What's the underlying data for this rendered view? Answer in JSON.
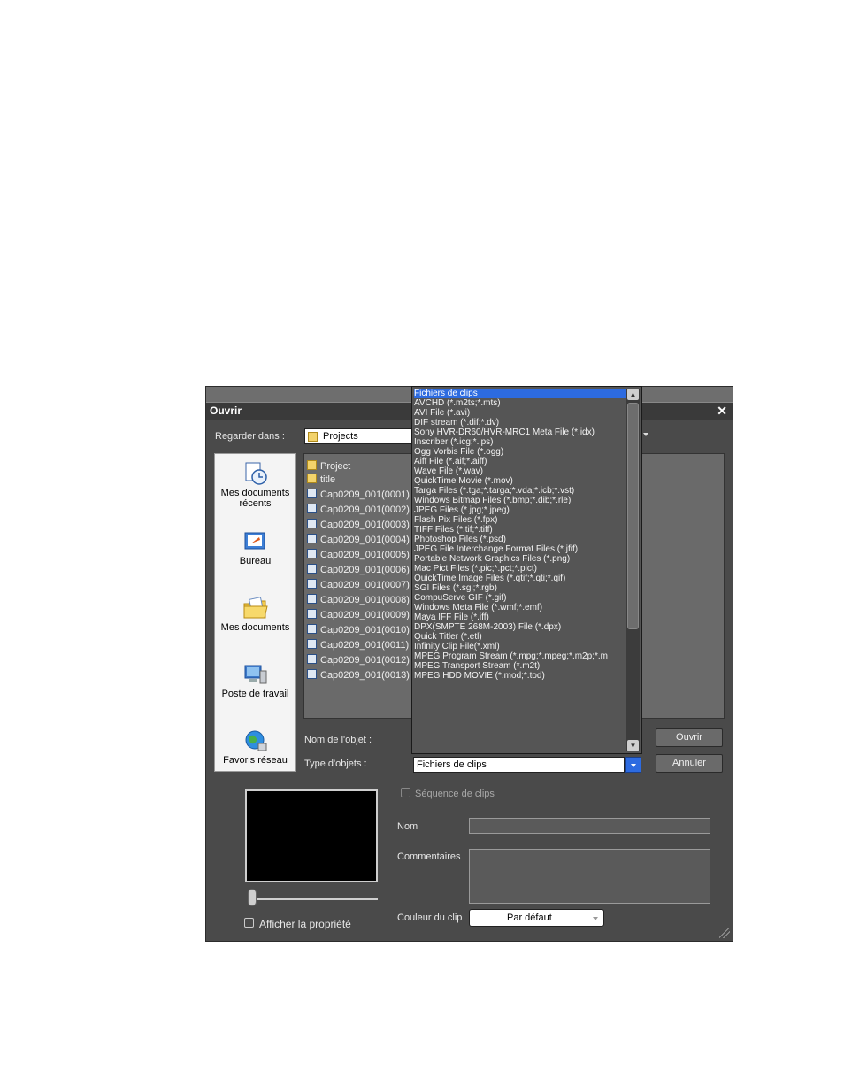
{
  "dialog": {
    "title": "Ouvrir",
    "look_in_label": "Regarder dans :",
    "look_in_value": "Projects",
    "object_name_label": "Nom de l'objet :",
    "object_name_value": "",
    "object_type_label": "Type d'objets :",
    "object_type_value": "Fichiers de clips",
    "open_button": "Ouvrir",
    "cancel_button": "Annuler"
  },
  "places": [
    {
      "label": "Mes documents récents",
      "icon": "recent-documents-icon"
    },
    {
      "label": "Bureau",
      "icon": "desktop-icon"
    },
    {
      "label": "Mes documents",
      "icon": "my-documents-icon"
    },
    {
      "label": "Poste de travail",
      "icon": "my-computer-icon"
    },
    {
      "label": "Favoris réseau",
      "icon": "network-places-icon"
    }
  ],
  "files": [
    {
      "name": "Project",
      "kind": "folder"
    },
    {
      "name": "title",
      "kind": "folder"
    },
    {
      "name": "Cap0209_001(0001)",
      "kind": "clip"
    },
    {
      "name": "Cap0209_001(0002)",
      "kind": "clip"
    },
    {
      "name": "Cap0209_001(0003)",
      "kind": "clip"
    },
    {
      "name": "Cap0209_001(0004)",
      "kind": "clip"
    },
    {
      "name": "Cap0209_001(0005)",
      "kind": "clip"
    },
    {
      "name": "Cap0209_001(0006)",
      "kind": "clip"
    },
    {
      "name": "Cap0209_001(0007)",
      "kind": "clip"
    },
    {
      "name": "Cap0209_001(0008)",
      "kind": "clip"
    },
    {
      "name": "Cap0209_001(0009)",
      "kind": "clip"
    },
    {
      "name": "Cap0209_001(0010)",
      "kind": "clip"
    },
    {
      "name": "Cap0209_001(0011)",
      "kind": "clip"
    },
    {
      "name": "Cap0209_001(0012)",
      "kind": "clip"
    },
    {
      "name": "Cap0209_001(0013)",
      "kind": "clip"
    }
  ],
  "file_types": [
    "Fichiers de clips",
    "AVCHD (*.m2ts;*.mts)",
    "AVI File (*.avi)",
    "DIF stream (*.dif;*.dv)",
    "Sony HVR-DR60/HVR-MRC1 Meta File (*.idx)",
    "Inscriber (*.icg;*.ips)",
    "Ogg Vorbis File (*.ogg)",
    "Aiff File (*.aif;*.aiff)",
    "Wave File (*.wav)",
    "QuickTime Movie (*.mov)",
    "Targa Files (*.tga;*.targa;*.vda;*.icb;*.vst)",
    "Windows Bitmap Files (*.bmp;*.dib;*.rle)",
    "JPEG Files (*.jpg;*.jpeg)",
    "Flash Pix Files (*.fpx)",
    "TIFF Files (*.tif;*.tiff)",
    "Photoshop Files (*.psd)",
    "JPEG File Interchange Format Files (*.jfif)",
    "Portable Network Graphics Files (*.png)",
    "Mac Pict Files (*.pic;*.pct;*.pict)",
    "QuickTime Image Files (*.qtif;*.qti;*.qif)",
    "SGI Files (*.sgi;*.rgb)",
    "CompuServe GIF (*.gif)",
    "Windows Meta File (*.wmf;*.emf)",
    "Maya IFF File (*.iff)",
    "DPX(SMPTE 268M-2003) File (*.dpx)",
    "Quick Titler (*.etl)",
    "Infinity Clip File(*.xml)",
    "MPEG Program Stream (*.mpg;*.mpeg;*.m2p;*.m",
    "MPEG Transport Stream (*.m2t)",
    "MPEG HDD MOVIE (*.mod;*.tod)"
  ],
  "properties": {
    "sequence_label": "Séquence de clips",
    "sequence_checked": false,
    "name_label": "Nom",
    "name_value": "",
    "comments_label": "Commentaires",
    "comments_value": "",
    "clip_color_label": "Couleur du clip",
    "clip_color_value": "Par défaut",
    "show_properties_label": "Afficher la propriété",
    "show_properties_checked": false
  },
  "colors": {
    "dialog_bg": "#4a4a4a",
    "selection": "#2d6be0",
    "list_bg": "#6a6a6a"
  }
}
